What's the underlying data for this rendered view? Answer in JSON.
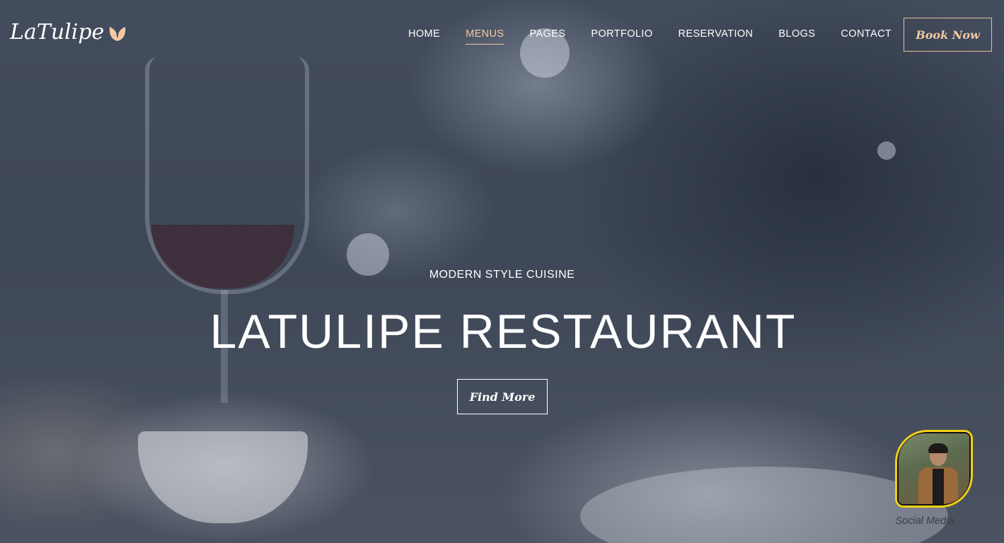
{
  "brand": {
    "name": "LaTulipe",
    "icon": "tulip-icon",
    "accent": "#f0c9a4"
  },
  "nav": {
    "items": [
      {
        "label": "HOME",
        "active": false
      },
      {
        "label": "MENUS",
        "active": true
      },
      {
        "label": "PAGES",
        "active": false
      },
      {
        "label": "PORTFOLIO",
        "active": false
      },
      {
        "label": "RESERVATION",
        "active": false
      },
      {
        "label": "BLOGS",
        "active": false
      },
      {
        "label": "CONTACT",
        "active": false
      }
    ],
    "cta_label": "Book Now"
  },
  "hero": {
    "eyebrow": "MODERN STYLE CUISINE",
    "title": "LATULIPE RESTAURANT",
    "button_label": "Find More"
  },
  "social_widget": {
    "label": "Social Media",
    "border_color": "#f2d013"
  }
}
